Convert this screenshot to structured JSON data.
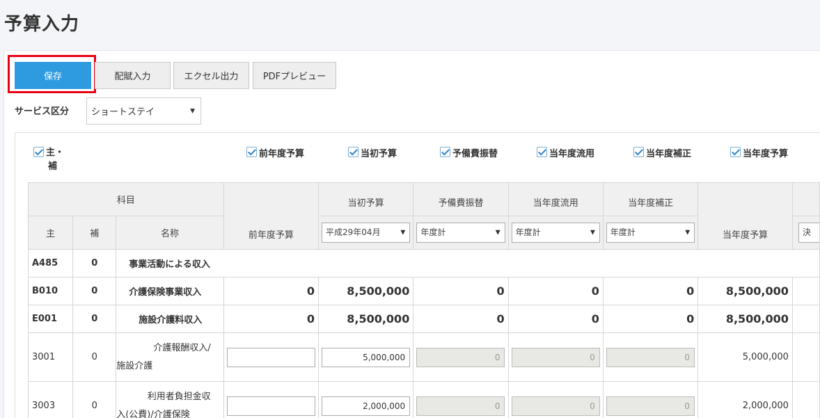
{
  "page": {
    "title": "予算入力"
  },
  "toolbar": {
    "save_label": "保存",
    "haifu_label": "配賦入力",
    "excel_label": "エクセル出力",
    "pdf_label": "PDFプレビュー"
  },
  "service": {
    "label": "サービス区分",
    "selected": "ショートステイ"
  },
  "columns_toggle": {
    "main_sub_line1": "主・",
    "main_sub_line2": "補",
    "prev_year": "前年度予算",
    "initial": "当初予算",
    "reserve": "予備費振替",
    "transfer": "当年度流用",
    "correction": "当年度補正",
    "current": "当年度予算"
  },
  "table": {
    "headers": {
      "kamoku": "科目",
      "main": "主",
      "sub": "補",
      "name": "名称",
      "prev_year": "前年度予算",
      "initial": "当初予算",
      "reserve": "予備費振替",
      "transfer": "当年度流用",
      "correction": "当年度補正",
      "current": "当年度予算",
      "extra_select": "決"
    },
    "selects": {
      "initial": "平成29年04月",
      "reserve": "年度計",
      "transfer": "年度計",
      "correction": "年度計"
    },
    "rows": [
      {
        "main": "A485",
        "sub": "0",
        "name": "事業活動による収入"
      },
      {
        "main": "B010",
        "sub": "0",
        "name": "介護保険事業収入",
        "prev": "0",
        "initial": "8,500,000",
        "reserve": "0",
        "transfer": "0",
        "correction": "0",
        "current": "8,500,000"
      },
      {
        "main": "E001",
        "sub": "0",
        "name": "施設介護料収入",
        "prev": "0",
        "initial": "8,500,000",
        "reserve": "0",
        "transfer": "0",
        "correction": "0",
        "current": "8,500,000"
      },
      {
        "main": "3001",
        "sub": "0",
        "name_line1": "介護報酬収入/",
        "name_line2": "施設介護",
        "prev": "",
        "initial": "5,000,000",
        "reserve": "0",
        "transfer": "0",
        "correction": "0",
        "current": "5,000,000"
      },
      {
        "main": "3003",
        "sub": "0",
        "name_line1": "利用者負担金収",
        "name_line2": "入(公費)/介護保険",
        "prev": "",
        "initial": "2,000,000",
        "reserve": "0",
        "transfer": "0",
        "correction": "0",
        "current": "2,000,000"
      }
    ]
  }
}
